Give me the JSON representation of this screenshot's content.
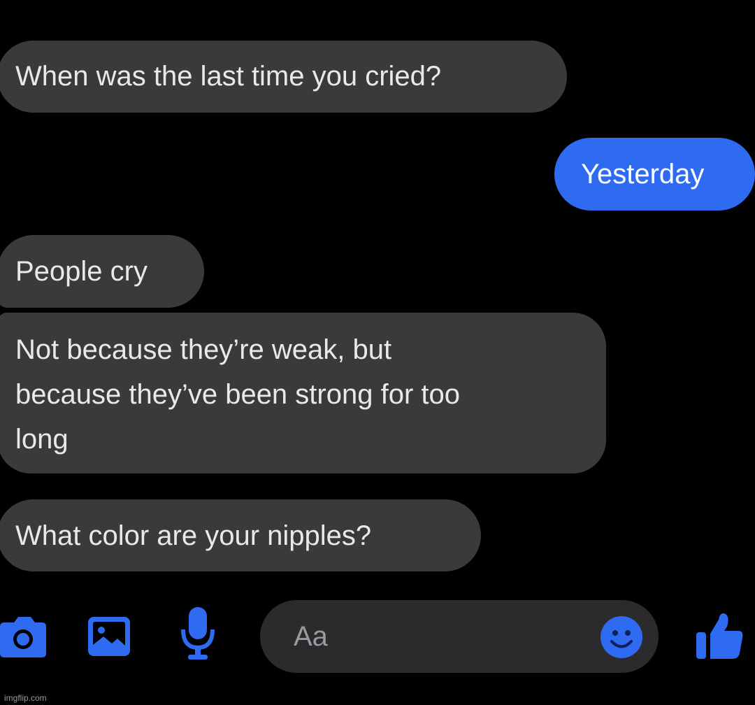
{
  "messages": [
    {
      "direction": "incoming",
      "text": "When was the last time you cried?"
    },
    {
      "direction": "outgoing",
      "text": "Yesterday"
    },
    {
      "direction": "incoming",
      "text": "People cry"
    },
    {
      "direction": "incoming",
      "lines": [
        "Not because they’re weak, but",
        "because they’ve been strong for too",
        "long"
      ]
    },
    {
      "direction": "incoming",
      "text": "What color are your nipples?"
    }
  ],
  "composer": {
    "placeholder": "Aa"
  },
  "toolbar": {
    "icons": [
      "camera-icon",
      "gallery-icon",
      "microphone-icon",
      "emoji-icon",
      "thumbs-up-icon"
    ]
  },
  "colors": {
    "background": "#000000",
    "incoming_bubble": "#3a3a3c",
    "outgoing_bubble": "#2f6bf0",
    "accent": "#2f6bf0"
  },
  "watermark": "imgflip.com"
}
